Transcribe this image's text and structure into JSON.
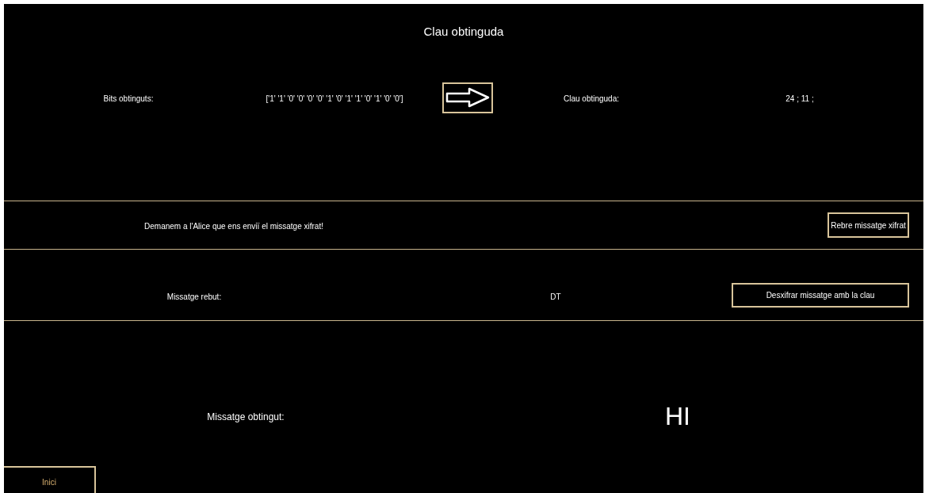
{
  "title": "Clau obtinguda",
  "key_section": {
    "bits_label": "Bits obtinguts:",
    "bits_value": "['1' '1' '0' '0' '0' '0' '1' '0' '1' '1' '0' '1' '0' '0']",
    "key_label": "Clau obtinguda:",
    "key_value": "24 ; 11 ;"
  },
  "request_section": {
    "text": "Demanem a l'Alice que ens enviï el missatge xifrat!",
    "button": "Rebre missatge xifrat"
  },
  "received_section": {
    "label": "Missatge rebut:",
    "value": "DT",
    "button": "Desxifrar missatge amb la clau"
  },
  "result_section": {
    "label": "Missatge obtingut:",
    "value": "HI"
  },
  "home_button": "Inici"
}
